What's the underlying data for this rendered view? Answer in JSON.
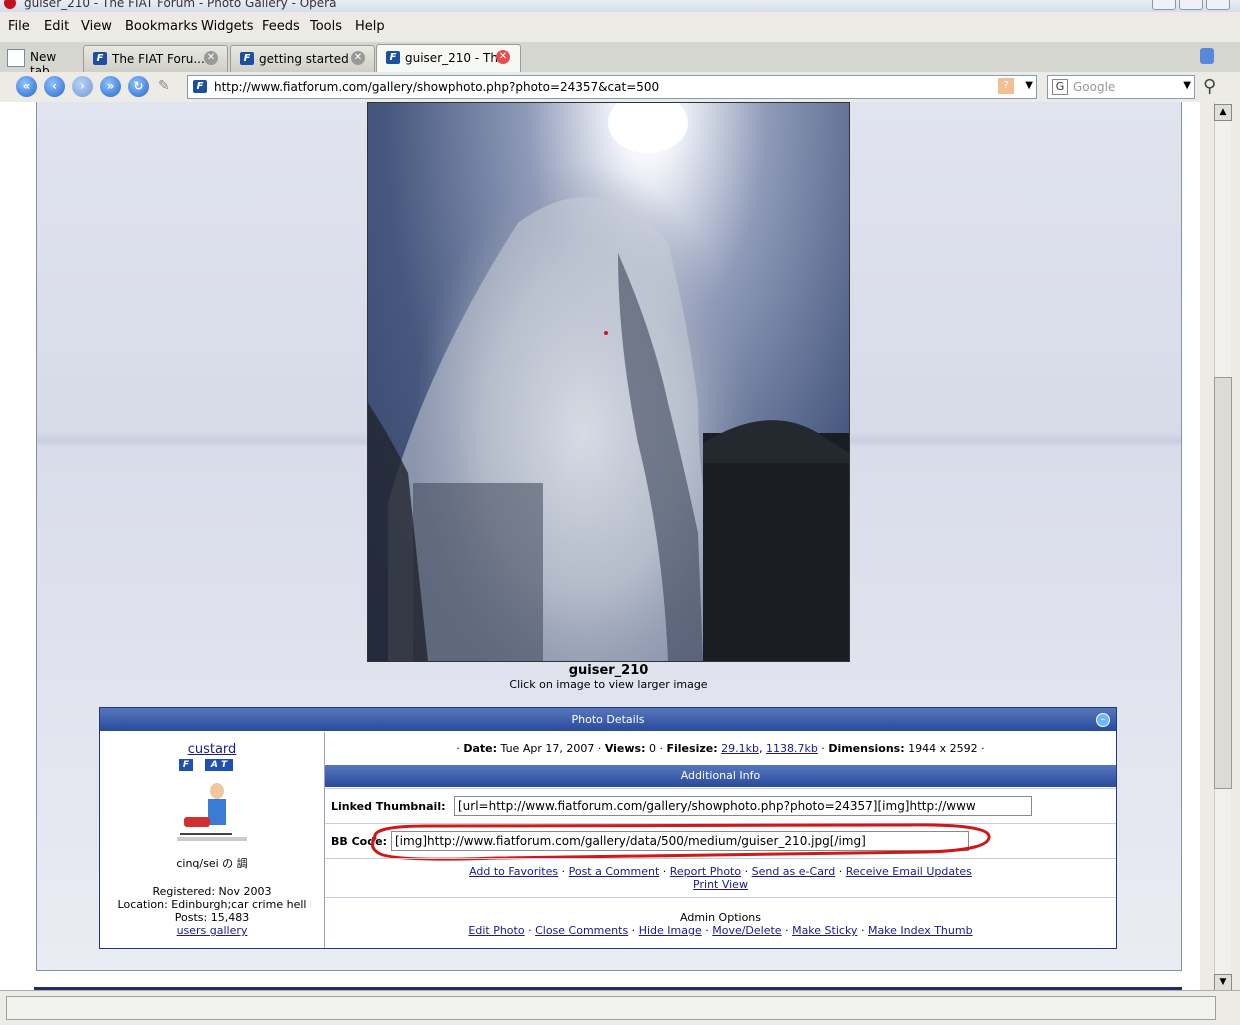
{
  "window": {
    "title": "guiser_210 - The FIAT Forum - Photo Gallery - Opera"
  },
  "menu": [
    "File",
    "Edit",
    "View",
    "Bookmarks",
    "Widgets",
    "Feeds",
    "Tools",
    "Help"
  ],
  "tabs": [
    {
      "label": "New tab"
    },
    {
      "label": "The FIAT Foru......"
    },
    {
      "label": "getting started ..."
    },
    {
      "label": "guiser_210 - Th..."
    }
  ],
  "address": {
    "url": "http://www.fiatforum.com/gallery/showphoto.php?photo=24357&cat=500"
  },
  "search": {
    "placeholder": "Google"
  },
  "photo": {
    "name": "guiser_210",
    "hint": "Click on image to view larger image"
  },
  "details": {
    "header": "Photo Details",
    "user": {
      "name": "custard",
      "avatar_badge": "F  A T",
      "tagline": "cinq/sei の 調",
      "registered": "Registered: Nov 2003",
      "location": "Location: Edinburgh;car crime hell",
      "posts": "Posts: 15,483",
      "gallery_link": "users gallery"
    },
    "meta": {
      "date_label": "Date:",
      "date": "Tue Apr 17, 2007",
      "views_label": "Views:",
      "views": "0",
      "filesize_label": "Filesize:",
      "size1": "29.1kb",
      "size2": "1138.7kb",
      "dim_label": "Dimensions:",
      "dimensions": "1944 x 2592"
    },
    "additional_header": "Additional Info",
    "linked_thumb_label": "Linked Thumbnail:",
    "linked_thumb_value": "[url=http://www.fiatforum.com/gallery/showphoto.php?photo=24357][img]http://www",
    "bbcode_label": "BB Code:",
    "bbcode_value": "[img]http://www.fiatforum.com/gallery/data/500/medium/guiser_210.jpg[/img]",
    "actions": [
      "Add to Favorites",
      "Post a Comment",
      "Report Photo",
      "Send as e-Card",
      "Receive Email Updates"
    ],
    "print_view": "Print View",
    "admin_title": "Admin Options",
    "admin_actions": [
      "Edit Photo",
      "Close Comments",
      "Hide Image",
      "Move/Delete",
      "Make Sticky",
      "Make Index Thumb"
    ]
  },
  "colors": {
    "header_blue": "#2a4a9c",
    "annotation_red": "#d01818",
    "link": "#1a1a8c"
  }
}
